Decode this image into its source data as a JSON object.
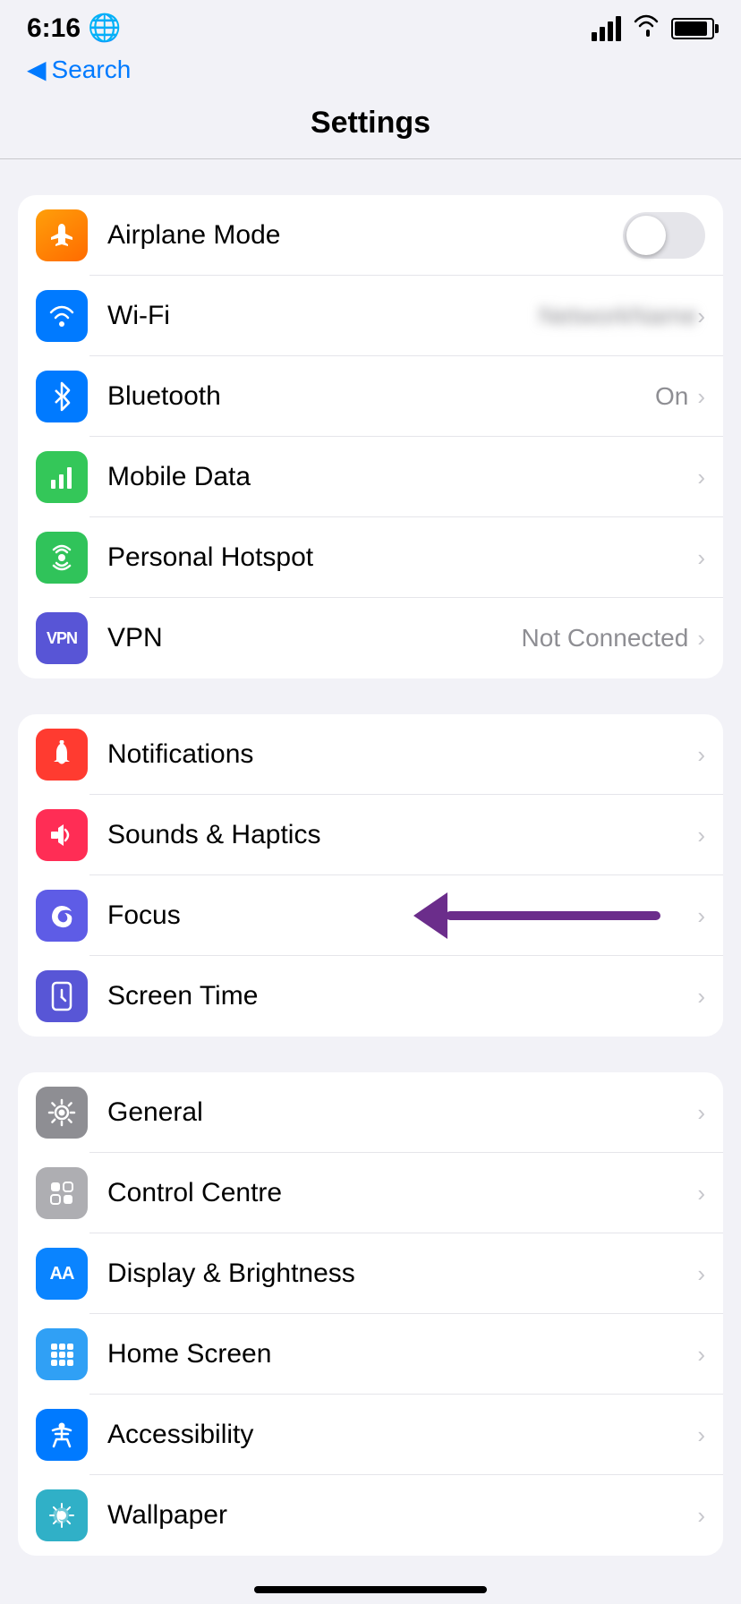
{
  "statusBar": {
    "time": "6:16",
    "globe": "🌐"
  },
  "navigation": {
    "back_label": "Search"
  },
  "pageTitle": "Settings",
  "group1": {
    "rows": [
      {
        "id": "airplane-mode",
        "label": "Airplane Mode",
        "value": "",
        "hasToggle": true,
        "toggleOn": false,
        "iconBg": "bg-orange",
        "iconSymbol": "✈"
      },
      {
        "id": "wifi",
        "label": "Wi-Fi",
        "value": "••••••••••••",
        "blurred": true,
        "hasChevron": true,
        "iconBg": "bg-blue",
        "iconSymbol": "wifi"
      },
      {
        "id": "bluetooth",
        "label": "Bluetooth",
        "value": "On",
        "hasChevron": true,
        "iconBg": "bg-blue",
        "iconSymbol": "bt"
      },
      {
        "id": "mobile-data",
        "label": "Mobile Data",
        "value": "",
        "hasChevron": true,
        "iconBg": "bg-green",
        "iconSymbol": "signal"
      },
      {
        "id": "personal-hotspot",
        "label": "Personal Hotspot",
        "value": "",
        "hasChevron": true,
        "iconBg": "bg-green2",
        "iconSymbol": "link"
      },
      {
        "id": "vpn",
        "label": "VPN",
        "value": "Not Connected",
        "hasChevron": true,
        "iconBg": "bg-vpn",
        "iconSymbol": "VPN"
      }
    ]
  },
  "group2": {
    "rows": [
      {
        "id": "notifications",
        "label": "Notifications",
        "value": "",
        "hasChevron": true,
        "iconBg": "bg-red",
        "iconSymbol": "bell"
      },
      {
        "id": "sounds-haptics",
        "label": "Sounds & Haptics",
        "value": "",
        "hasChevron": true,
        "iconBg": "bg-red2",
        "iconSymbol": "speaker"
      },
      {
        "id": "focus",
        "label": "Focus",
        "value": "",
        "hasChevron": true,
        "iconBg": "bg-purple",
        "iconSymbol": "moon",
        "hasArrow": true
      },
      {
        "id": "screen-time",
        "label": "Screen Time",
        "value": "",
        "hasChevron": true,
        "iconBg": "bg-purple2",
        "iconSymbol": "hourglass"
      }
    ]
  },
  "group3": {
    "rows": [
      {
        "id": "general",
        "label": "General",
        "value": "",
        "hasChevron": true,
        "iconBg": "bg-gray",
        "iconSymbol": "gear"
      },
      {
        "id": "control-centre",
        "label": "Control Centre",
        "value": "",
        "hasChevron": true,
        "iconBg": "bg-gray2",
        "iconSymbol": "sliders"
      },
      {
        "id": "display-brightness",
        "label": "Display & Brightness",
        "value": "",
        "hasChevron": true,
        "iconBg": "bg-blue2",
        "iconSymbol": "AA"
      },
      {
        "id": "home-screen",
        "label": "Home Screen",
        "value": "",
        "hasChevron": true,
        "iconBg": "bg-blue3",
        "iconSymbol": "grid"
      },
      {
        "id": "accessibility",
        "label": "Accessibility",
        "value": "",
        "hasChevron": true,
        "iconBg": "bg-blue",
        "iconSymbol": "person"
      },
      {
        "id": "wallpaper",
        "label": "Wallpaper",
        "value": "",
        "hasChevron": true,
        "iconBg": "bg-teal",
        "iconSymbol": "flower"
      }
    ]
  }
}
